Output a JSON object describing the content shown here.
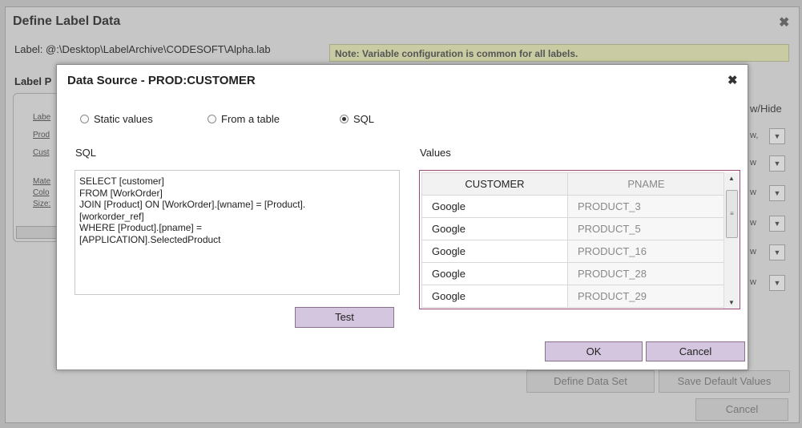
{
  "outer": {
    "title": "Define Label Data",
    "close_glyph": "✖",
    "label_path": "Label: @:\\Desktop\\LabelArchive\\CODESOFT\\Alpha.lab",
    "note": "Note: Variable configuration is common for all labels.",
    "label_prop": "Label P",
    "side_links": [
      "Labe",
      "Prod",
      "Cust",
      "Mate",
      "Colo",
      "Size:"
    ],
    "show_hide": "w/Hide",
    "row_selects": [
      "w,",
      "w",
      "w",
      "w",
      "w",
      "w"
    ],
    "buttons": {
      "define_data_set": "Define Data Set",
      "save_default": "Save Default Values",
      "cancel": "Cancel"
    }
  },
  "dialog": {
    "title": "Data Source - PROD:CUSTOMER",
    "close_glyph": "✖",
    "radios": [
      {
        "label": "Static values",
        "selected": false
      },
      {
        "label": "From a table",
        "selected": false
      },
      {
        "label": "SQL",
        "selected": true
      }
    ],
    "sql_label": "SQL",
    "sql_text": "SELECT [customer]\nFROM [WorkOrder]\nJOIN [Product] ON [WorkOrder].[wname] = [Product].\n[workorder_ref]\nWHERE [Product].[pname] =\n[APPLICATION].SelectedProduct",
    "test_label": "Test",
    "values_label": "Values",
    "grid": {
      "columns": [
        "CUSTOMER",
        "PNAME"
      ],
      "rows": [
        [
          "Google",
          "PRODUCT_3"
        ],
        [
          "Google",
          "PRODUCT_5"
        ],
        [
          "Google",
          "PRODUCT_16"
        ],
        [
          "Google",
          "PRODUCT_28"
        ],
        [
          "Google",
          "PRODUCT_29"
        ]
      ]
    },
    "ok_label": "OK",
    "cancel_label": "Cancel"
  },
  "colors": {
    "accent_border": "#9a4a7a",
    "button_fill": "#d3c6de",
    "note_fill": "#c9cba2"
  }
}
